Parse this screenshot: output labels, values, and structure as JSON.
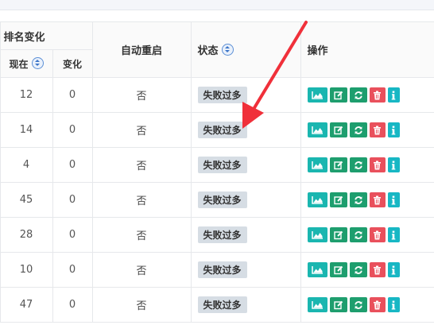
{
  "table": {
    "headers": {
      "rank_change": "排名变化",
      "now": "现在",
      "change": "变化",
      "auto_restart": "自动重启",
      "status": "状态",
      "operations": "操作"
    },
    "rows": [
      {
        "now": "12",
        "change": "0",
        "auto_restart": "否",
        "status": "失败过多"
      },
      {
        "now": "14",
        "change": "0",
        "auto_restart": "否",
        "status": "失败过多"
      },
      {
        "now": "4",
        "change": "0",
        "auto_restart": "否",
        "status": "失败过多"
      },
      {
        "now": "45",
        "change": "0",
        "auto_restart": "否",
        "status": "失败过多"
      },
      {
        "now": "28",
        "change": "0",
        "auto_restart": "否",
        "status": "失败过多"
      },
      {
        "now": "10",
        "change": "0",
        "auto_restart": "否",
        "status": "失败过多"
      },
      {
        "now": "47",
        "change": "0",
        "auto_restart": "否",
        "status": "失败过多"
      }
    ],
    "action_icons": [
      "chart-icon",
      "edit-icon",
      "refresh-icon",
      "delete-icon",
      "info-icon"
    ]
  },
  "colors": {
    "chart_button": "#1ab6b0",
    "edit_button": "#1e9e6e",
    "refresh_button": "#1e9e6e",
    "delete_button": "#e9505c",
    "info_button": "#17b7c4",
    "status_badge": "#d6dde4",
    "annotation_arrow": "#f0303a"
  }
}
